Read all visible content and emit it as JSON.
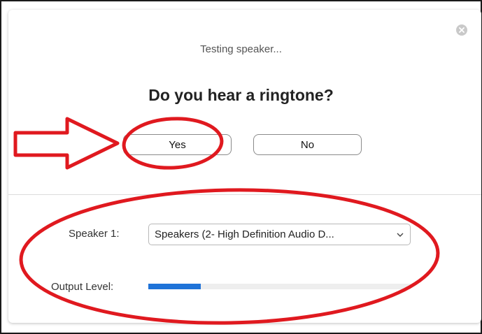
{
  "dialog": {
    "subtitle": "Testing speaker...",
    "question": "Do you hear a ringtone?",
    "yes_label": "Yes",
    "no_label": "No"
  },
  "speaker": {
    "label": "Speaker 1:",
    "selected": "Speakers (2- High Definition Audio D..."
  },
  "output": {
    "label": "Output Level:",
    "level": 0.2
  },
  "icons": {
    "close": "close-icon",
    "dropdown": "chevron-down-icon",
    "arrow": "arrow-right-annotation"
  },
  "colors": {
    "accent": "#1f73d8",
    "annotation": "#e0191f"
  }
}
